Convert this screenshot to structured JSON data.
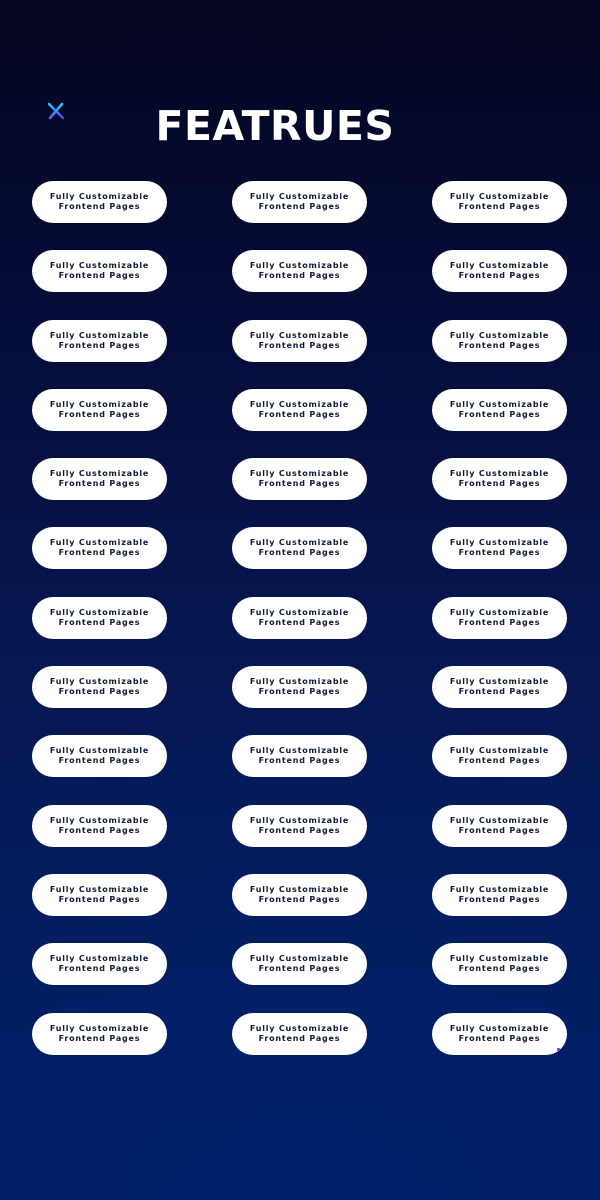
{
  "header": {
    "title": "FEATRUES",
    "icon": "close-x-icon",
    "icon_colors": [
      "#27c4f5",
      "#5b3cf2"
    ]
  },
  "features": [
    "Fully Customizable\nFrontend Pages",
    "Fully Customizable\nFrontend Pages",
    "Fully Customizable\nFrontend Pages",
    "Fully Customizable\nFrontend Pages",
    "Fully Customizable\nFrontend Pages",
    "Fully Customizable\nFrontend Pages",
    "Fully Customizable\nFrontend Pages",
    "Fully Customizable\nFrontend Pages",
    "Fully Customizable\nFrontend Pages",
    "Fully Customizable\nFrontend Pages",
    "Fully Customizable\nFrontend Pages",
    "Fully Customizable\nFrontend Pages",
    "Fully Customizable\nFrontend Pages",
    "Fully Customizable\nFrontend Pages",
    "Fully Customizable\nFrontend Pages",
    "Fully Customizable\nFrontend Pages",
    "Fully Customizable\nFrontend Pages",
    "Fully Customizable\nFrontend Pages",
    "Fully Customizable\nFrontend Pages",
    "Fully Customizable\nFrontend Pages",
    "Fully Customizable\nFrontend Pages",
    "Fully Customizable\nFrontend Pages",
    "Fully Customizable\nFrontend Pages",
    "Fully Customizable\nFrontend Pages",
    "Fully Customizable\nFrontend Pages",
    "Fully Customizable\nFrontend Pages",
    "Fully Customizable\nFrontend Pages",
    "Fully Customizable\nFrontend Pages",
    "Fully Customizable\nFrontend Pages",
    "Fully Customizable\nFrontend Pages",
    "Fully Customizable\nFrontend Pages",
    "Fully Customizable\nFrontend Pages",
    "Fully Customizable\nFrontend Pages",
    "Fully Customizable\nFrontend Pages",
    "Fully Customizable\nFrontend Pages",
    "Fully Customizable\nFrontend Pages",
    "Fully Customizable\nFrontend Pages",
    "Fully Customizable\nFrontend Pages",
    "Fully Customizable\nFrontend Pages"
  ],
  "colors": {
    "background_top": "#04051f",
    "background_bottom": "#021d63",
    "pill_background": "#ffffff",
    "pill_text": "#121a36",
    "title_text": "#ffffff"
  }
}
